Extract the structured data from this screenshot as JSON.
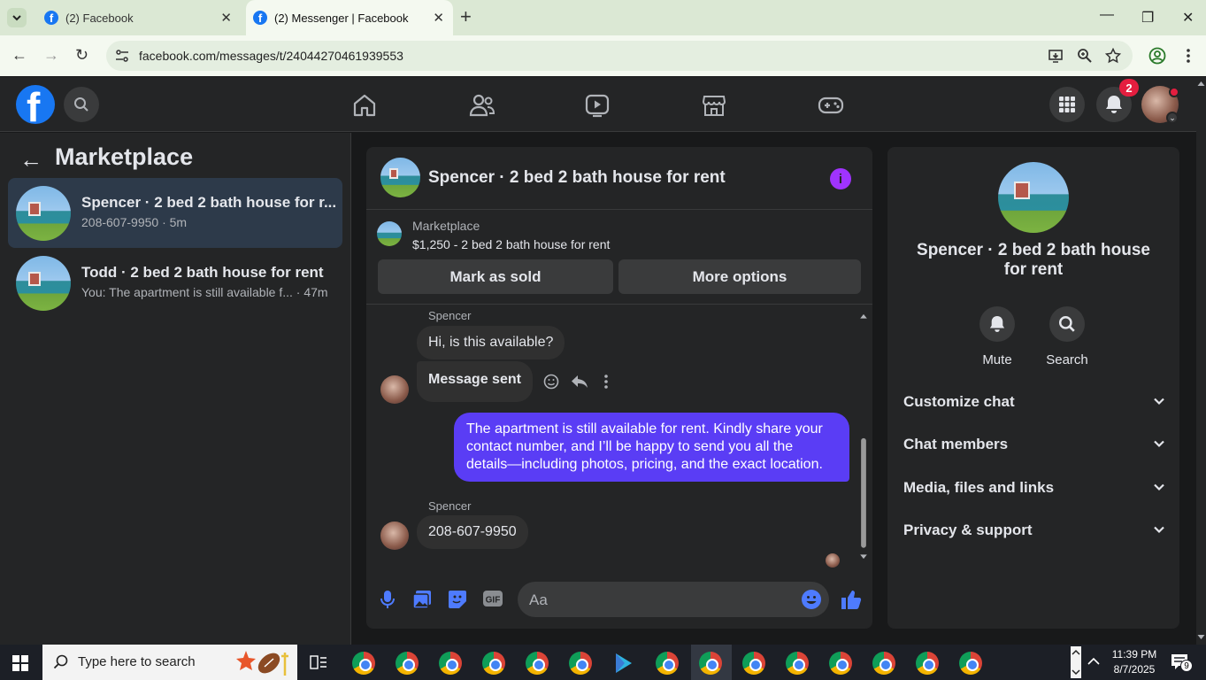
{
  "browser": {
    "tabs": [
      {
        "title": "(2) Facebook"
      },
      {
        "title": "(2) Messenger | Facebook"
      }
    ],
    "url": "facebook.com/messages/t/24044270461939553"
  },
  "fbnav": {
    "notification_count": "2"
  },
  "left_panel": {
    "title": "Marketplace",
    "conversations": [
      {
        "name": "Spencer · 2 bed 2 bath house for r...",
        "preview": "208-607-9950 · 5m"
      },
      {
        "name": "Todd · 2 bed 2 bath house for rent",
        "preview": "You: The apartment is still available f... · 47m"
      }
    ]
  },
  "chat": {
    "title": "Spencer · 2 bed 2 bath house for rent",
    "listing": {
      "source": "Marketplace",
      "price_title": "$1,250 - 2 bed 2 bath house for rent"
    },
    "buttons": {
      "mark_sold": "Mark as sold",
      "more_options": "More options"
    },
    "messages": [
      {
        "sender": "Spencer",
        "text": "Hi, is this available?"
      },
      {
        "text": "Message sent"
      },
      {
        "text": "The apartment is still available for rent. Kindly share your contact number, and I’ll be happy to send you all the details—including photos, pricing, and the exact location."
      },
      {
        "sender": "Spencer",
        "text": "208-607-9950"
      }
    ],
    "composer_placeholder": "Aa"
  },
  "right_panel": {
    "title": "Spencer · 2 bed 2 bath house for rent",
    "actions": {
      "mute": "Mute",
      "search": "Search"
    },
    "sections": [
      {
        "label": "Customize chat"
      },
      {
        "label": "Chat members"
      },
      {
        "label": "Media, files and links"
      },
      {
        "label": "Privacy & support"
      }
    ]
  },
  "taskbar": {
    "search_placeholder": "Type here to search",
    "time": "11:39 PM",
    "date": "8/7/2025",
    "notifications": "9"
  },
  "colors": {
    "fb_blue": "#1877f2",
    "my_bubble": "#5a3df5",
    "dark_bg": "#18191a",
    "panel": "#242526"
  }
}
